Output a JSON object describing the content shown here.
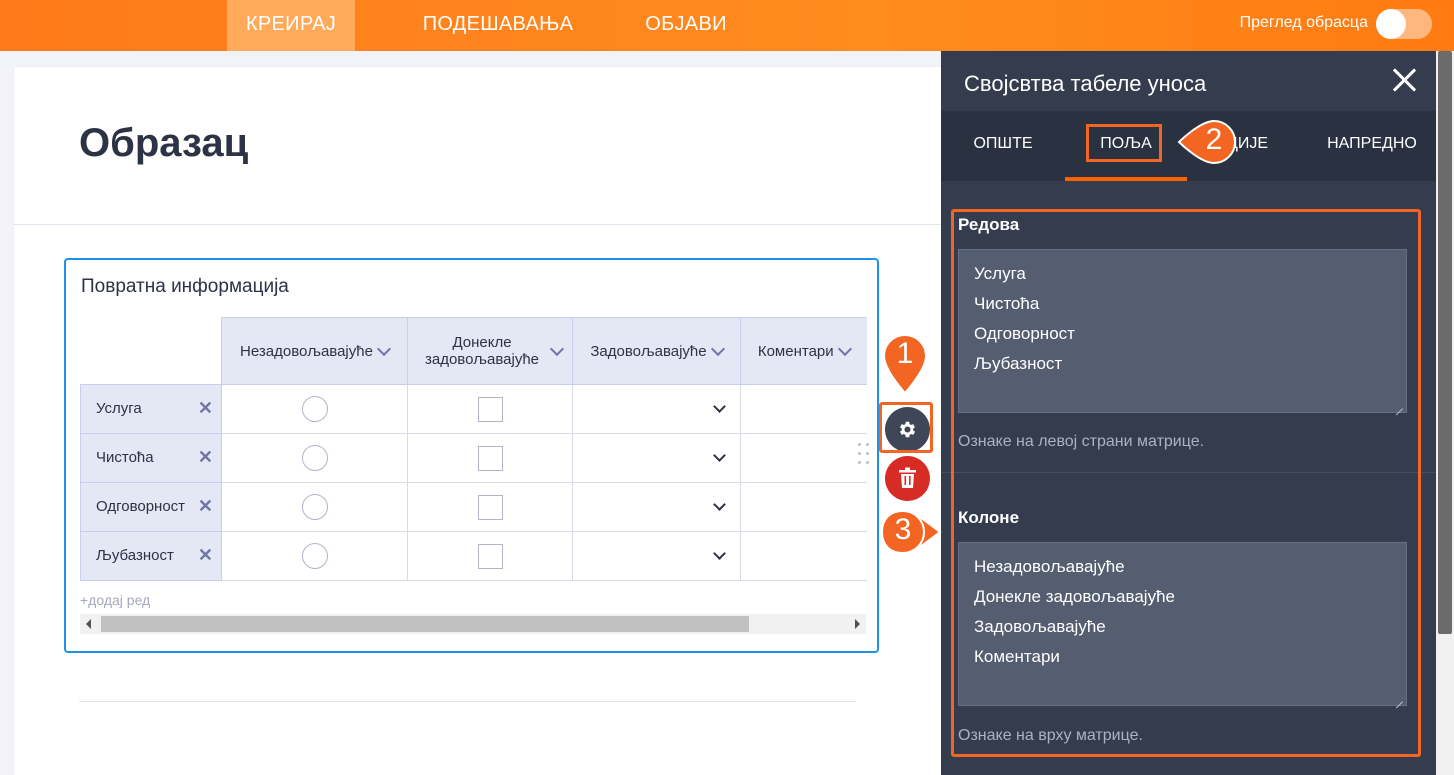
{
  "topnav": {
    "tabs": [
      {
        "label": "КРЕИРАЈ",
        "active": true
      },
      {
        "label": "ПОДЕШАВАЊА",
        "active": false
      },
      {
        "label": "ОБЈАВИ",
        "active": false
      }
    ],
    "preview_label": "Преглед обрасца",
    "preview_toggle_on": false
  },
  "form": {
    "title": "Образац",
    "field": {
      "label": "Повратна информација",
      "columns": [
        "Незадовољавајуће",
        "Донекле задовољавајуће",
        "Задовољавајуће",
        "Коментари"
      ],
      "rows": [
        "Услуга",
        "Чистоћа",
        "Одговорност",
        "Љубазност"
      ],
      "add_row": "+додај ред"
    }
  },
  "callouts": [
    "1",
    "2",
    "3"
  ],
  "panel": {
    "title": "Својсвтва табеле уноса",
    "tabs": [
      "ОПШТЕ",
      "ПОЉА",
      "ЦИЈЕ",
      "НАПРЕДНО"
    ],
    "active_tab": "ПОЉА",
    "rows_section": {
      "label": "Редова",
      "lines": [
        "Услуга",
        "Чистоћа",
        "Одговорност",
        "Љубазност"
      ],
      "hint": "Ознаке на левој страни матрице."
    },
    "columns_section": {
      "label": "Колоне",
      "lines": [
        "Незадовољавајуће",
        "Донекле задовољавајуће",
        "Задовољавајуће",
        "Коментари"
      ],
      "hint": "Ознаке на врху матрице."
    }
  },
  "colors": {
    "brand_orange": "#ff7a1a",
    "callout_orange": "#f26522",
    "panel_bg": "#343c4e",
    "field_border": "#1f91e7",
    "delete_red": "#d72b26"
  }
}
